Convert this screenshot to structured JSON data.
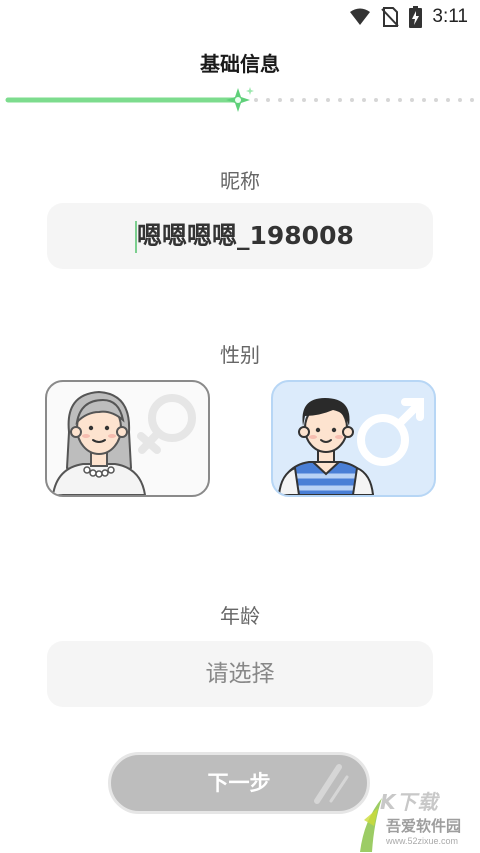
{
  "status_bar": {
    "time": "3:11",
    "icons": [
      "wifi-icon",
      "no-sim-icon",
      "battery-charging-icon"
    ]
  },
  "header": {
    "title": "基础信息"
  },
  "progress": {
    "fraction": 0.5,
    "accent": "#7ddc8e"
  },
  "nickname": {
    "label": "昵称",
    "value": "嗯嗯嗯嗯_198008"
  },
  "gender": {
    "label": "性别",
    "options": [
      {
        "id": "female",
        "icon": "female-symbol-icon",
        "selected": false
      },
      {
        "id": "male",
        "icon": "male-symbol-icon",
        "selected": true
      }
    ]
  },
  "age": {
    "label": "年龄",
    "placeholder": "请选择"
  },
  "actions": {
    "next_label": "下一步"
  },
  "watermark": {
    "line1": "K下载",
    "line2": "吾爱软件园",
    "url": "www.52zixue.com"
  }
}
